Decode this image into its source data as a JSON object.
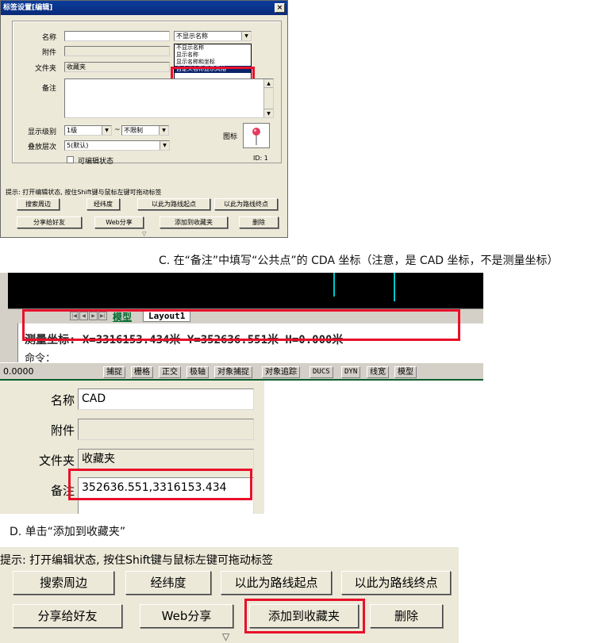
{
  "dialog": {
    "title": "标签设置[编辑]",
    "close": "×",
    "name_label": "名称",
    "attach_label": "附件",
    "folder_label": "文件夹",
    "folder_value": "收藏夹",
    "note_label": "备注",
    "display_select": "不显示名称",
    "display_options": [
      "不显示名称",
      "显示名称",
      "显示名称和坐标",
      "自定义名称显示风格"
    ],
    "selected_option": "自定义名称显示风格",
    "level_label": "显示级别",
    "level_from": "1级",
    "level_sep": "~",
    "level_to": "不限制",
    "overlay_label": "叠放层次",
    "overlay_value": "5(默认)",
    "edit_checkbox": "可编辑状态",
    "icon_label": "图标",
    "id_text": "ID: 1",
    "hint": "提示: 打开编辑状态, 按住Shift键与鼠标左键可拖动标签",
    "buttons": {
      "search": "搜索周边",
      "latlon": "经纬度",
      "start": "以此为路线起点",
      "end": "以此为路线终点",
      "share": "分享给好友",
      "web": "Web分享",
      "favorite": "添加到收藏夹",
      "delete": "删除"
    }
  },
  "step_c": "C.  在“备注”中填写“公共点”的 CDA 坐标（注意，是 CAD 坐标，不是测量坐标）",
  "cad": {
    "tab_model": "模型",
    "tab_layout": "Layout1",
    "coords": "测量坐标: X=3316153.434米  Y=352636.551米  H=0.000米",
    "command": "命令：",
    "status_value": "0.0000",
    "status_buttons": [
      "捕捉",
      "栅格",
      "正交",
      "极轴",
      "对象捕捉",
      "对象追踪",
      "DUCS",
      "DYN",
      "线宽",
      "模型"
    ]
  },
  "form": {
    "name_label": "名称",
    "name_value": "CAD",
    "attach_label": "附件",
    "folder_label": "文件夹",
    "folder_value": "收藏夹",
    "note_label": "备注",
    "note_value": "352636.551,3316153.434"
  },
  "step_d": "D.  单击“添加到收藏夹”",
  "bottom": {
    "hint": "提示: 打开编辑状态, 按住Shift键与鼠标左键可拖动标签",
    "search": "搜索周边",
    "latlon": "经纬度",
    "start": "以此为路线起点",
    "end": "以此为路线终点",
    "share": "分享给好友",
    "web": "Web分享",
    "favorite": "添加到收藏夹",
    "delete": "删除"
  },
  "colors": {
    "highlight": "#e8102a",
    "title_bar": "#0a3d9c",
    "cad_green": "#006b2e",
    "cad_line": "#00c8c8"
  }
}
